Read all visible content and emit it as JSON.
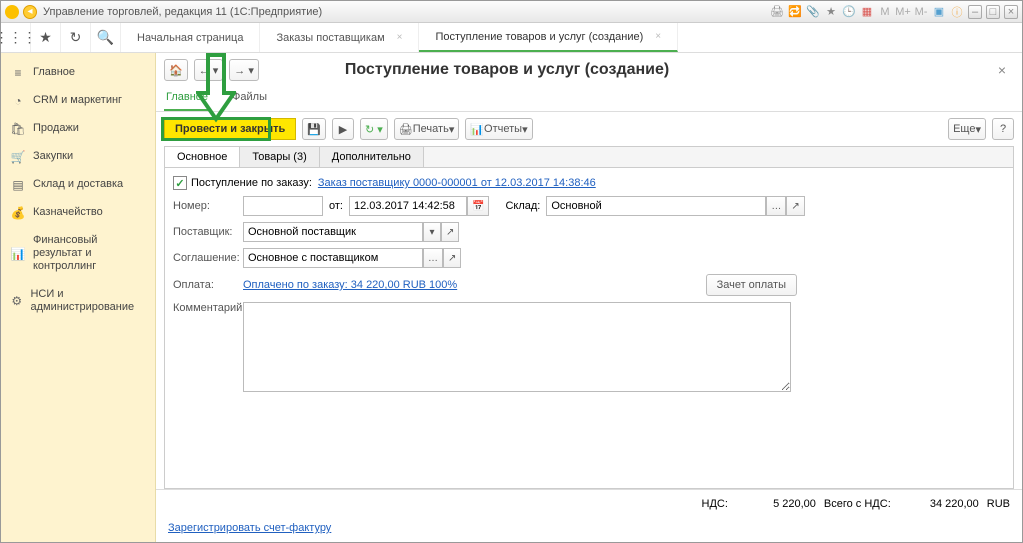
{
  "titlebar": {
    "title": "Управление торговлей, редакция 11  (1С:Предприятие)"
  },
  "win_btns": {
    "minimize": "–",
    "maximize": "□",
    "close": "×"
  },
  "tabs": [
    {
      "label": "Начальная страница"
    },
    {
      "label": "Заказы поставщикам"
    },
    {
      "label": "Поступление товаров и услуг (создание)"
    }
  ],
  "sidebar": [
    {
      "icon": "≡",
      "label": "Главное"
    },
    {
      "icon": "◔",
      "label": "CRM и маркетинг"
    },
    {
      "icon": "🛍",
      "label": "Продажи"
    },
    {
      "icon": "🛒",
      "label": "Закупки"
    },
    {
      "icon": "▤",
      "label": "Склад и доставка"
    },
    {
      "icon": "💰",
      "label": "Казначейство"
    },
    {
      "icon": "📊",
      "label": "Финансовый результат и контроллинг"
    },
    {
      "icon": "⚙",
      "label": "НСИ и администрирование"
    }
  ],
  "page": {
    "title": "Поступление товаров и услуг (создание)",
    "subtabs": [
      "Главное",
      "Файлы"
    ],
    "actions": {
      "post_close": "Провести и закрыть",
      "print": "Печать",
      "reports": "Отчеты",
      "more": "Еще"
    },
    "inner_tabs": [
      "Основное",
      "Товары (3)",
      "Дополнительно"
    ],
    "order_checkbox_label": "Поступление по заказу:",
    "order_link": "Заказ поставщику 0000-000001 от 12.03.2017 14:38:46",
    "number_label": "Номер:",
    "date_label": "от:",
    "date_value": "12.03.2017 14:42:58",
    "warehouse_label": "Склад:",
    "warehouse_value": "Основной",
    "supplier_label": "Поставщик:",
    "supplier_value": "Основной поставщик",
    "agreement_label": "Соглашение:",
    "agreement_value": "Основное с поставщиком",
    "payment_label": "Оплата:",
    "payment_link": "Оплачено по заказу: 34 220,00 RUB  100%",
    "offset_btn": "Зачет оплаты",
    "comment_label": "Комментарий:",
    "footer": {
      "vat_label": "НДС:",
      "vat_value": "5 220,00",
      "total_label": "Всего с НДС:",
      "total_value": "34 220,00",
      "currency": "RUB"
    },
    "register_link": "Зарегистрировать счет-фактуру"
  }
}
